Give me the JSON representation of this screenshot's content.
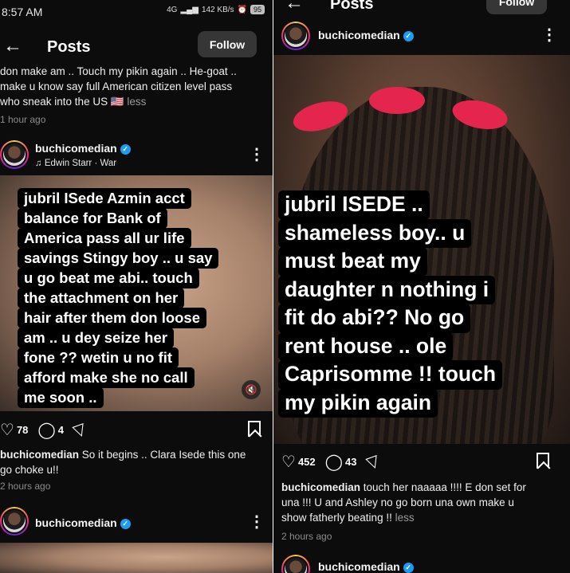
{
  "left": {
    "status": {
      "time": "8:57 AM",
      "network": "4G",
      "speed": "142 KB/s",
      "battery": "95"
    },
    "header": {
      "back_icon": "arrow-left-icon",
      "title": "Posts",
      "follow_label": "Follow"
    },
    "prev_post": {
      "caption_lines": [
        "don make am .. Touch my pikin again .. He-goat ..",
        "make u know say full American citizen level pass",
        "who sneak into the US 🇺🇸"
      ],
      "less_label": "less",
      "time": "1 hour ago"
    },
    "post": {
      "username": "buchicomedian",
      "music": "Edwin Starr · War",
      "overlay_lines": [
        "jubril ISede Azmin acct",
        "balance for Bank of",
        "America pass all ur life",
        "savings Stingy boy .. u say",
        "u go beat me abi.. touch",
        "the attachment on her",
        "hair after them don  loose",
        "am .. u dey seize her",
        "fone ?? wetin u no fit",
        "afford make she no call",
        "me soon .."
      ],
      "likes": "78",
      "comments": "4",
      "caption_user": "buchicomedian",
      "caption_line1": "So it begins .. Clara Isede this one",
      "caption_line2": "go choke u!!",
      "time": "2 hours ago"
    },
    "next_post": {
      "username": "buchicomedian"
    }
  },
  "right": {
    "header": {
      "back_icon": "arrow-left-icon",
      "title": "Posts",
      "follow_label": "Follow"
    },
    "post": {
      "username": "buchicomedian",
      "overlay_lines": [
        "jubril ISEDE ..",
        "shameless boy.. u",
        "must beat my",
        "daughter n nothing i",
        "fit do abi?? No go",
        "rent house .. ole",
        "Caprisomme !! touch",
        "my pikin again"
      ],
      "likes": "452",
      "comments": "43",
      "caption_user": "buchicomedian",
      "caption_line1": "touch her naaaaa !!!! E don set for",
      "caption_line2": "una !!! U and Ashley  no go born una own make u",
      "caption_line3": "show fatherly beating !!",
      "less_label": "less",
      "time": "2 hours ago"
    },
    "next_post": {
      "username": "buchicomedian"
    }
  }
}
